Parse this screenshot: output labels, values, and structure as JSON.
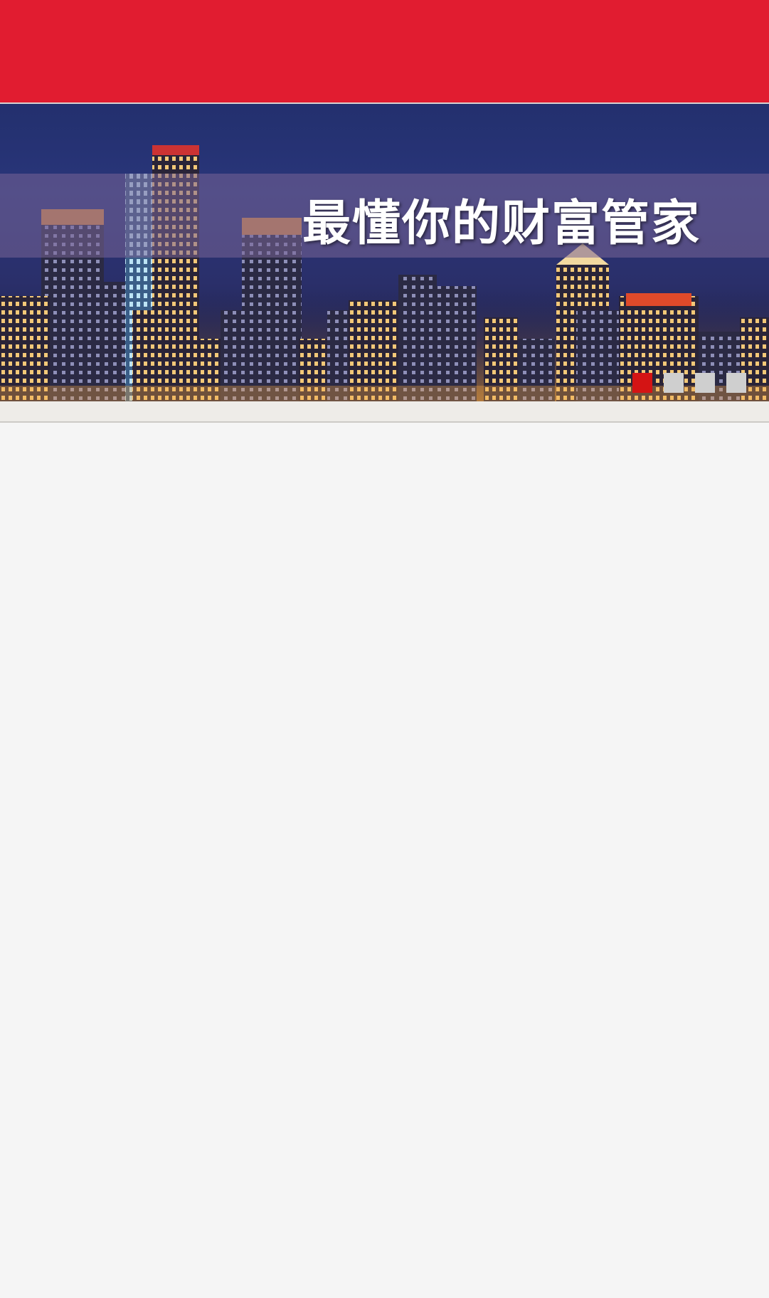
{
  "banner": {
    "slogan": "最懂你的财富管家",
    "slides_total": 4,
    "active_slide": 1
  },
  "colors": {
    "header_red": "#e11c30",
    "active_dot": "#d41414",
    "inactive_dot": "#cfcfcf",
    "page_bg": "#f5f5f5"
  }
}
